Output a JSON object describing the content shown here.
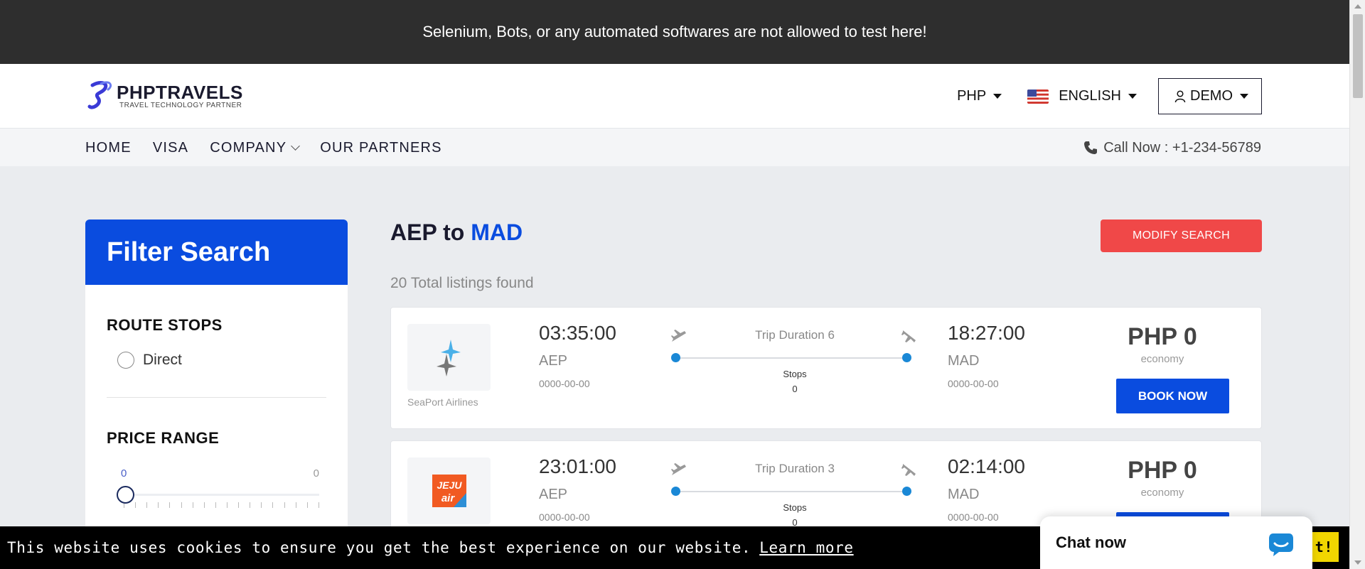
{
  "banner": {
    "text": "Selenium, Bots, or any automated softwares are not allowed to test here!"
  },
  "header": {
    "logo_name": "PHPTRAVELS",
    "logo_tagline": "TRAVEL TECHNOLOGY PARTNER",
    "currency": "PHP",
    "language": "ENGLISH",
    "account": "DEMO"
  },
  "nav": {
    "items": [
      "HOME",
      "VISA",
      "COMPANY",
      "OUR PARTNERS"
    ],
    "call": "Call Now : +1-234-56789"
  },
  "sidebar": {
    "title": "Filter Search",
    "route_stops_title": "ROUTE STOPS",
    "direct_label": "Direct",
    "price_range_title": "PRICE RANGE",
    "price_min": "0",
    "price_max": "0"
  },
  "results": {
    "from": "AEP",
    "to_word": "to",
    "to": "MAD",
    "modify_label": "MODIFY SEARCH",
    "count_text": "20 Total listings found",
    "stops_label": "Stops",
    "book_label": "BOOK NOW",
    "flights": [
      {
        "airline": "SeaPort Airlines",
        "dep_time": "03:35:00",
        "dep_code": "AEP",
        "dep_date": "0000-00-00",
        "duration": "Trip Duration 6",
        "stops": "0",
        "arr_time": "18:27:00",
        "arr_code": "MAD",
        "arr_date": "0000-00-00",
        "price": "PHP 0",
        "cabin": "economy"
      },
      {
        "airline": "Jeju Air",
        "dep_time": "23:01:00",
        "dep_code": "AEP",
        "dep_date": "0000-00-00",
        "duration": "Trip Duration 3",
        "stops": "0",
        "arr_time": "02:14:00",
        "arr_code": "MAD",
        "arr_date": "0000-00-00",
        "price": "PHP 0",
        "cabin": "economy"
      }
    ]
  },
  "cookie": {
    "text": "This website uses cookies to ensure you get the best experience on our website.",
    "link": "Learn more",
    "button": "t!"
  },
  "chat": {
    "label": "Chat now"
  },
  "colors": {
    "primary": "#0a4cdf",
    "danger": "#f04848",
    "banner_bg": "#2e2e2e"
  },
  "icons": [
    "logo-icon",
    "caret-icon",
    "us-flag-icon",
    "user-icon",
    "chevron-down-icon",
    "phone-icon",
    "takeoff-icon",
    "landing-icon",
    "chat-bubble-icon"
  ]
}
